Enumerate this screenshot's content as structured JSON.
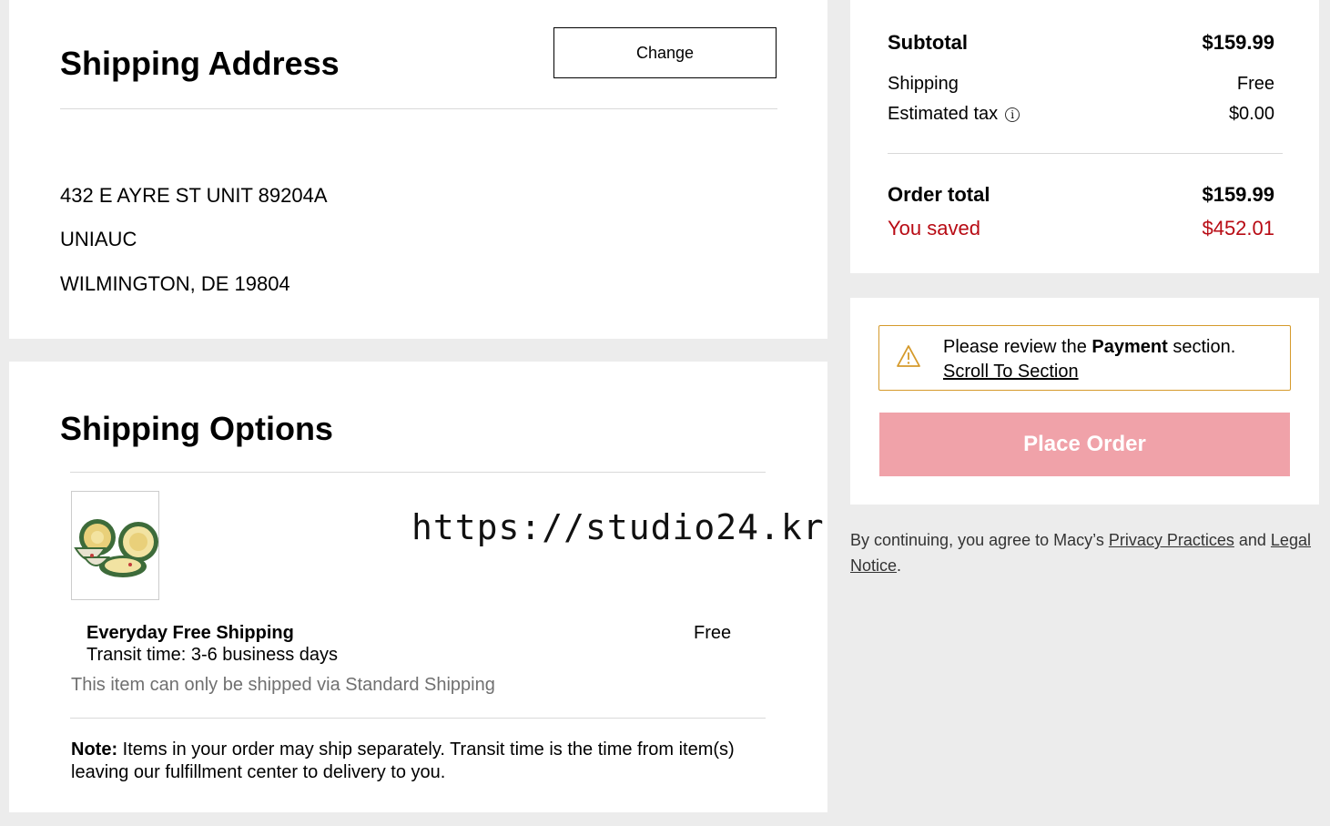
{
  "shipping_address": {
    "title": "Shipping Address",
    "change_label": "Change",
    "lines": [
      "432 E AYRE ST UNIT 89204A",
      "UNIAUC",
      "WILMINGTON, DE 19804"
    ]
  },
  "shipping_options": {
    "title": "Shipping Options",
    "watermark": "https://studio24.kr",
    "method": "Everyday Free Shipping",
    "transit": "Transit time: 3-6 business days",
    "price": "Free",
    "restriction": "This item can only be shipped via Standard Shipping",
    "note_label": "Note:",
    "note_text": " Items in your order may ship separately. Transit time is the time from item(s) leaving our fulfillment center to delivery to you."
  },
  "summary": {
    "subtotal_label": "Subtotal",
    "subtotal_value": "$159.99",
    "shipping_label": "Shipping",
    "shipping_value": "Free",
    "tax_label": "Estimated tax",
    "tax_value": "$0.00",
    "total_label": "Order total",
    "total_value": "$159.99",
    "saved_label": "You saved",
    "saved_value": "$452.01"
  },
  "order": {
    "alert_prefix": "Please review the ",
    "alert_bold": "Payment",
    "alert_suffix": " section.",
    "alert_link": "Scroll To Section",
    "place_order_label": "Place Order"
  },
  "legal": {
    "prefix": "By continuing, you agree to Macy’s ",
    "privacy_link": "Privacy Practices",
    "middle": " and ",
    "legal_link": "Legal Notice",
    "suffix": "."
  },
  "colors": {
    "saved": "#b80b14",
    "place_order_bg": "#f0a2a9",
    "alert_border": "#d59a2b"
  }
}
